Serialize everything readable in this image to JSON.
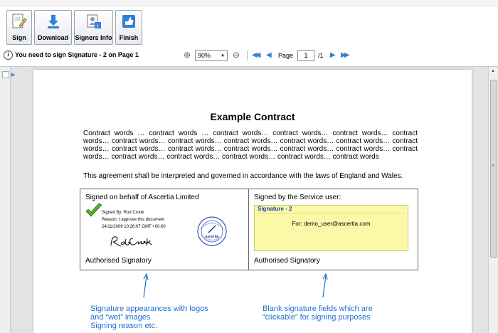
{
  "toolbar": {
    "buttons": [
      {
        "label": "Sign",
        "icon": "sign-icon"
      },
      {
        "label": "Download",
        "icon": "download-icon"
      },
      {
        "label": "Signers Info",
        "icon": "signers-info-icon"
      },
      {
        "label": "Finish",
        "icon": "finish-icon"
      }
    ]
  },
  "nav": {
    "message": "You need to sign Signature - 2 on Page 1",
    "zoom": "90%",
    "page_label": "Page",
    "page_value": "1",
    "page_total": "/1"
  },
  "document": {
    "title": "Example Contract",
    "paragraph": "Contract words … contract words … contract words… contract words… contract words… contract words… contract words… contract words… contract words… contract words… contract words… contract words… contract words… contract words… contract words… contract words… contract words… contract words… contract words… contract words… contract words… contract words… contract words",
    "law_clause": "This agreement shall be interpreted and governed in accordance with the laws of England and Wales.",
    "left_cell": {
      "heading": "Signed on behalf of Ascertia Limited",
      "signed_by": "Signed By: Rod Crook",
      "reason": "Reason: I approve this document",
      "timestamp": "24/11/2009 10:26:07 GMT +00:00",
      "seal_text": "ascertia",
      "footer": "Authorised Signatory"
    },
    "right_cell": {
      "heading": "Signed by the Service user:",
      "field_title": "Signature - 2",
      "field_for": "For: demo_user@ascertia.com",
      "footer": "Authorised Signatory"
    }
  },
  "annotations": {
    "left_lines": [
      "Signature appearances with logos",
      "and “wet” images",
      "Signing reason etc."
    ],
    "right_lines": [
      "Blank signature fields which are",
      "“clickable” for signing purposes"
    ]
  },
  "colors": {
    "annotation": "#1f6fd1",
    "signature_field_bg": "#fbf9a8",
    "signature_field_title": "#1a3fb0",
    "check": "#4caf2a"
  }
}
